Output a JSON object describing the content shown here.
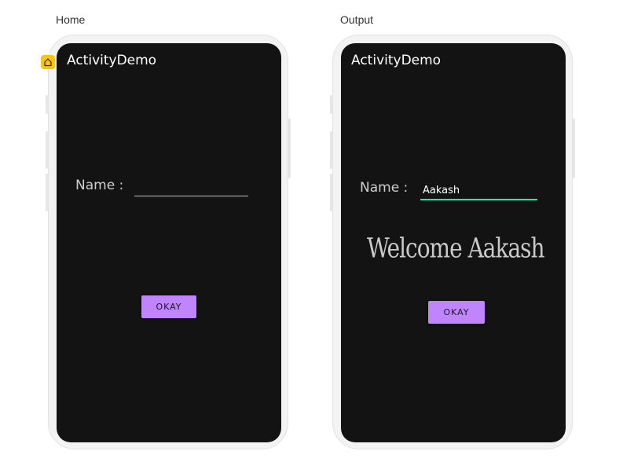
{
  "frames": [
    {
      "label": "Home",
      "app_title": "ActivityDemo",
      "name_label": "Name :",
      "name_value": "",
      "button_label": "OKAY",
      "welcome_text": ""
    },
    {
      "label": "Output",
      "app_title": "ActivityDemo",
      "name_label": "Name :",
      "name_value": "Aakash",
      "button_label": "OKAY",
      "welcome_text": "Welcome  Aakash"
    }
  ],
  "colors": {
    "screen_bg": "#131313",
    "button_bg": "#c084fc",
    "input_focus_line": "#1de9b6",
    "input_line": "#bdbdbd",
    "home_badge": "#f9c50a"
  },
  "icons": {
    "home_badge": "home-icon"
  }
}
